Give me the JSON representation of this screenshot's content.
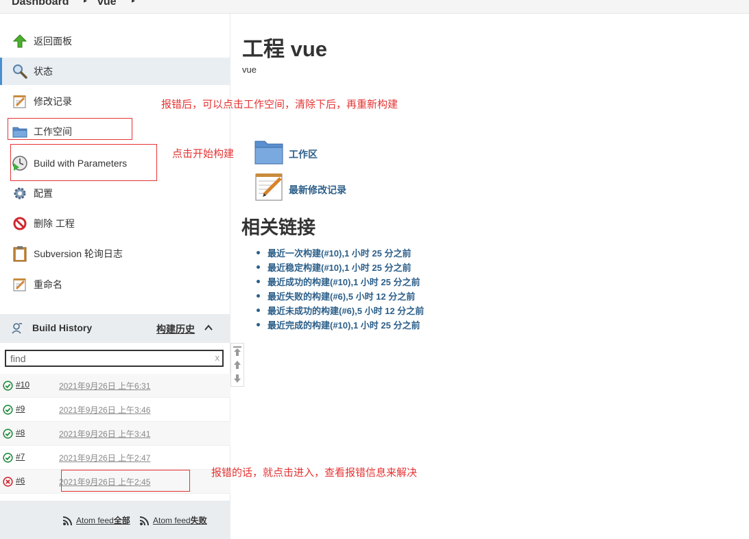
{
  "breadcrumb": {
    "root": "Dashboard",
    "job": "vue"
  },
  "sidebar": {
    "tasks": [
      {
        "label": "返回面板",
        "icon": "up-arrow-icon"
      },
      {
        "label": "状态",
        "icon": "magnifier-icon"
      },
      {
        "label": "修改记录",
        "icon": "notepad-icon"
      },
      {
        "label": "工作空间",
        "icon": "folder-icon"
      },
      {
        "label": "Build with Parameters",
        "icon": "clock-play-icon"
      },
      {
        "label": "配置",
        "icon": "gear-icon"
      },
      {
        "label": "删除 工程",
        "icon": "no-entry-icon"
      },
      {
        "label": "Subversion 轮询日志",
        "icon": "clipboard-icon"
      },
      {
        "label": "重命名",
        "icon": "notepad-icon"
      }
    ]
  },
  "build_history": {
    "title": "Build History",
    "trend_link": "构建历史",
    "find_placeholder": "find",
    "find_clear": "x",
    "builds": [
      {
        "number": "#10",
        "date": "2021年9月26日 上午6:31",
        "status": "success"
      },
      {
        "number": "#9",
        "date": "2021年9月26日 上午3:46",
        "status": "success"
      },
      {
        "number": "#8",
        "date": "2021年9月26日 上午3:41",
        "status": "success"
      },
      {
        "number": "#7",
        "date": "2021年9月26日 上午2:47",
        "status": "success"
      },
      {
        "number": "#6",
        "date": "2021年9月26日 上午2:45",
        "status": "failure"
      }
    ],
    "feeds": {
      "all_prefix": "Atom feed ",
      "all": "全部",
      "fail_prefix": "Atom feed ",
      "fail": "失败"
    }
  },
  "main": {
    "title": "工程 vue",
    "description": "vue",
    "workspace_link": "工作区",
    "changes_link": "最新修改记录",
    "permalinks_heading": "相关链接",
    "permalinks": [
      "最近一次构建(#10),1 小时 25 分之前",
      "最近稳定构建(#10),1 小时 25 分之前",
      "最近成功的构建(#10),1 小时 25 分之前",
      "最近失败的构建(#6),5 小时 12 分之前",
      "最近未成功的构建(#6),5 小时 12 分之前",
      "最近完成的构建(#10),1 小时 25 分之前"
    ]
  },
  "annotations": {
    "workspace_note": "报错后，可以点击工作空间，清除下后，再重新构建",
    "build_note": "点击开始构建",
    "error_note": "报错的话，就点击进入，查看报错信息来解决"
  },
  "colors": {
    "link": "#2c5f8a",
    "annotation": "#e53333",
    "success": "#1e8a3c",
    "failure": "#d0262f"
  }
}
